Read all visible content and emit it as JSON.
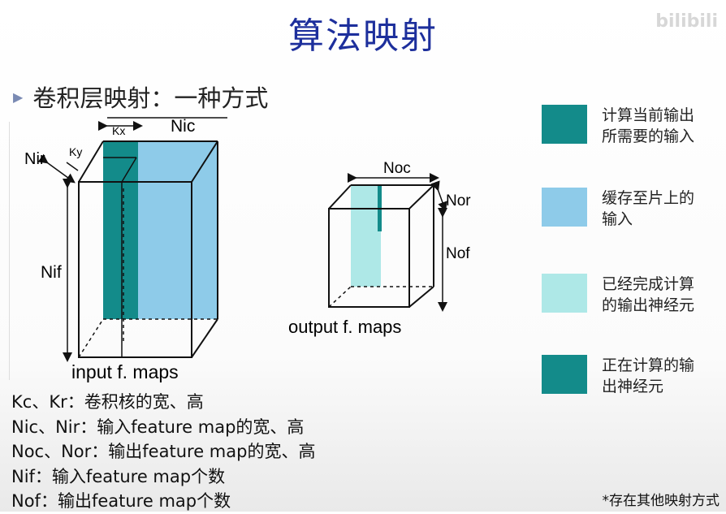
{
  "slide": {
    "title": "算法映射",
    "bullet": "卷积层映射：一种方式",
    "watermark": "bilibili"
  },
  "input_diagram": {
    "caption": "input f. maps",
    "labels": {
      "nic": "Nic",
      "nir": "Nir",
      "kx": "Kx",
      "ky": "Ky",
      "nif": "Nif"
    }
  },
  "output_diagram": {
    "caption": "output f. maps",
    "labels": {
      "noc": "Noc",
      "nor": "Nor",
      "nof": "Nof"
    }
  },
  "legend": [
    {
      "label": "计算当前输出\n所需要的输入",
      "color": "#138b8a"
    },
    {
      "label": "缓存至片上的\n输入",
      "color": "#8ecbe9"
    },
    {
      "label": "已经完成计算\n的输出神经元",
      "color": "#aee8e7"
    },
    {
      "label": "正在计算的输\n出神经元",
      "color": "#138b8a"
    }
  ],
  "definitions": [
    "Kc、Kr：卷积核的宽、高",
    "Nic、Nir：输入feature map的宽、高",
    "Noc、Nor：输出feature map的宽、高",
    "Nif：输入feature map个数",
    "Nof：输出feature map个数"
  ],
  "note": "*存在其他映射方式",
  "colors": {
    "title": "#1d2f9c",
    "teal": "#138b8a",
    "light_blue": "#8ecbe9",
    "light_cyan": "#aee8e7"
  }
}
